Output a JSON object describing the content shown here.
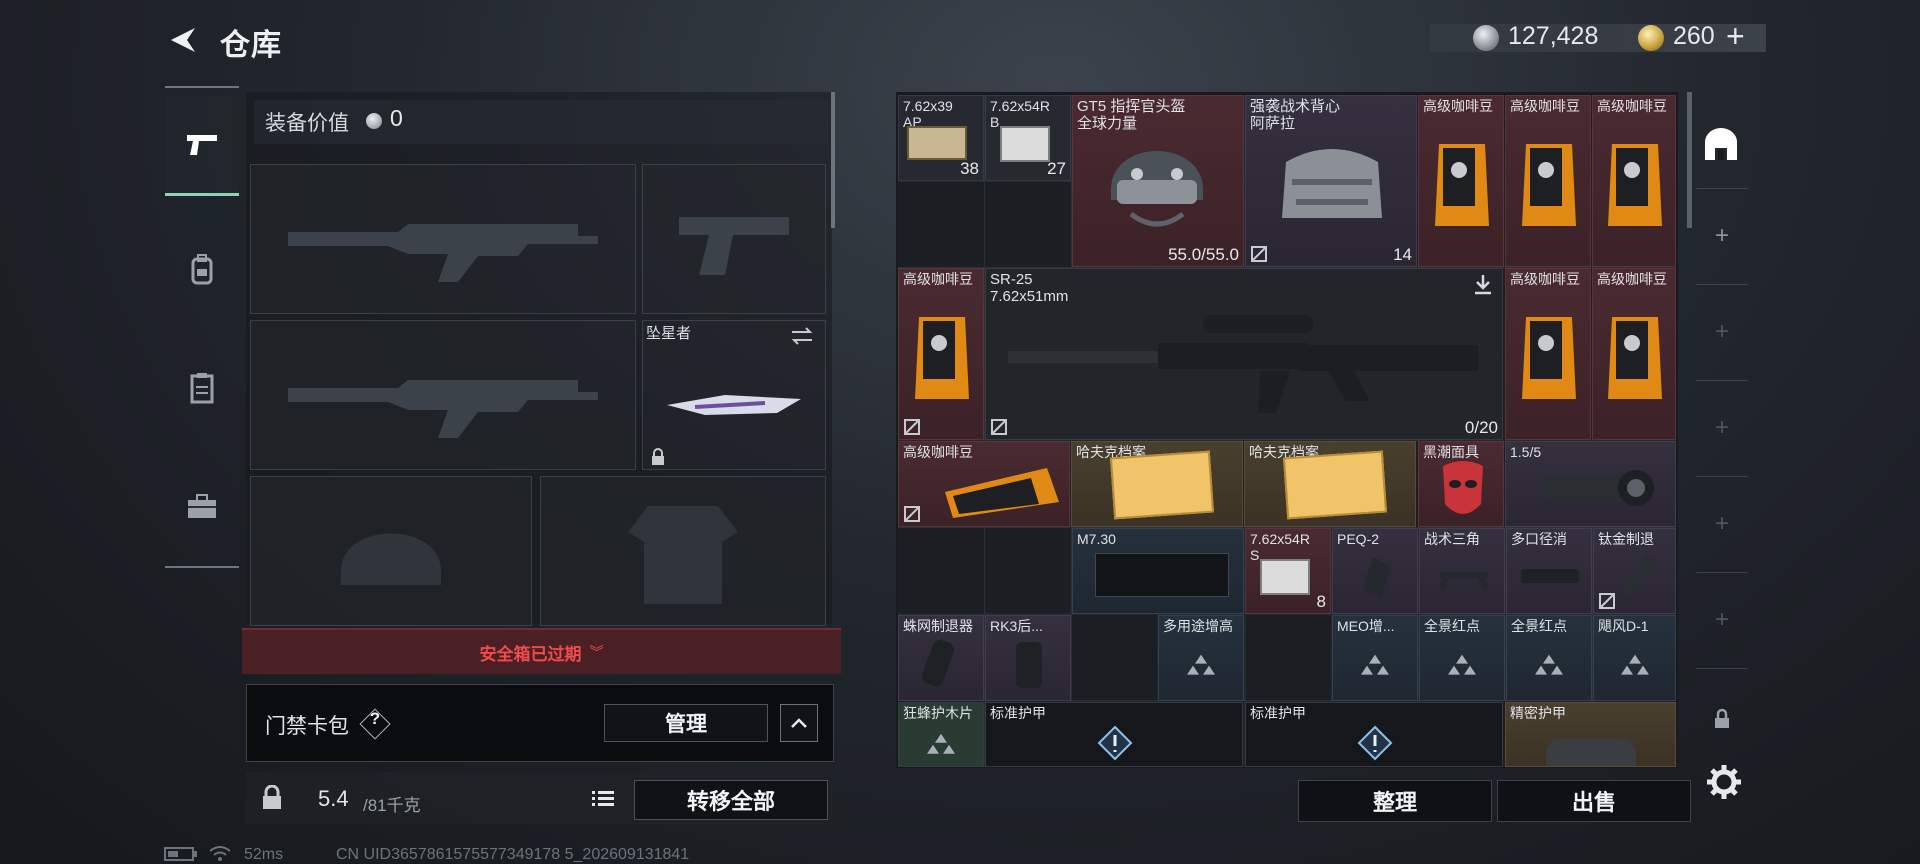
{
  "header": {
    "title": "仓库"
  },
  "currency": {
    "silver": "127,428",
    "gold": "260"
  },
  "loadout": {
    "equip_label": "装备价值",
    "equip_value": "0",
    "melee_name": "坠星者",
    "safebox_text": "安全箱已过期"
  },
  "cardpack": {
    "label": "门禁卡包",
    "help": "?",
    "manage": "管理"
  },
  "capacity": {
    "current": "5.4",
    "max": "/81千克",
    "transfer": "转移全部"
  },
  "items": {
    "ammo1_name": "7.62x39\nAP",
    "ammo1_count": "38",
    "ammo2_name": "7.62x54R\nB",
    "ammo2_count": "27",
    "helmet_name": "GT5 指挥官头盔\n全球力量",
    "helmet_dur": "55.0/55.0",
    "vest_name": "强袭战术背心\n阿萨拉",
    "vest_count": "14",
    "coffee": "高级咖啡豆",
    "rifle_name": "SR-25\n7.62x51mm",
    "rifle_ammo": "0/20",
    "archive": "哈夫克档案",
    "mask": "黑潮面具",
    "scope": "1.5/5",
    "m730": "M7.30",
    "ammo3_name": "7.62x54R\nS",
    "ammo3_count": "8",
    "peq": "PEQ-2",
    "tripod": "战术三角",
    "suppressor": "多口径消",
    "titanium": "钛金制退",
    "spider": "蛛网制退器",
    "rk3": "RK3后...",
    "multi": "多用途增高",
    "meo": "MEO增...",
    "panoramic": "全景红点",
    "hurricane": "飓风D-1",
    "wolf": "狂蜂护木片",
    "armor": "标准护甲",
    "precision": "精密护甲"
  },
  "actions": {
    "tidy": "整理",
    "sell": "出售"
  },
  "status": {
    "ping": "52ms",
    "uid": "CN UID3657861575577349178 5_202609131841"
  },
  "colors": {
    "accent_green": "#8fd2b4",
    "danger": "#f14b4b"
  },
  "icons": [
    "back-arrow-icon",
    "silver-coin-icon",
    "gold-coin-icon",
    "pistol-icon",
    "backpack-icon",
    "vest-icon",
    "toolbox-icon",
    "lock-icon",
    "help-icon",
    "chevron-up-icon",
    "list-icon",
    "arch-icon",
    "plus-icon",
    "gear-icon",
    "download-icon",
    "battery-icon",
    "wifi-icon"
  ]
}
